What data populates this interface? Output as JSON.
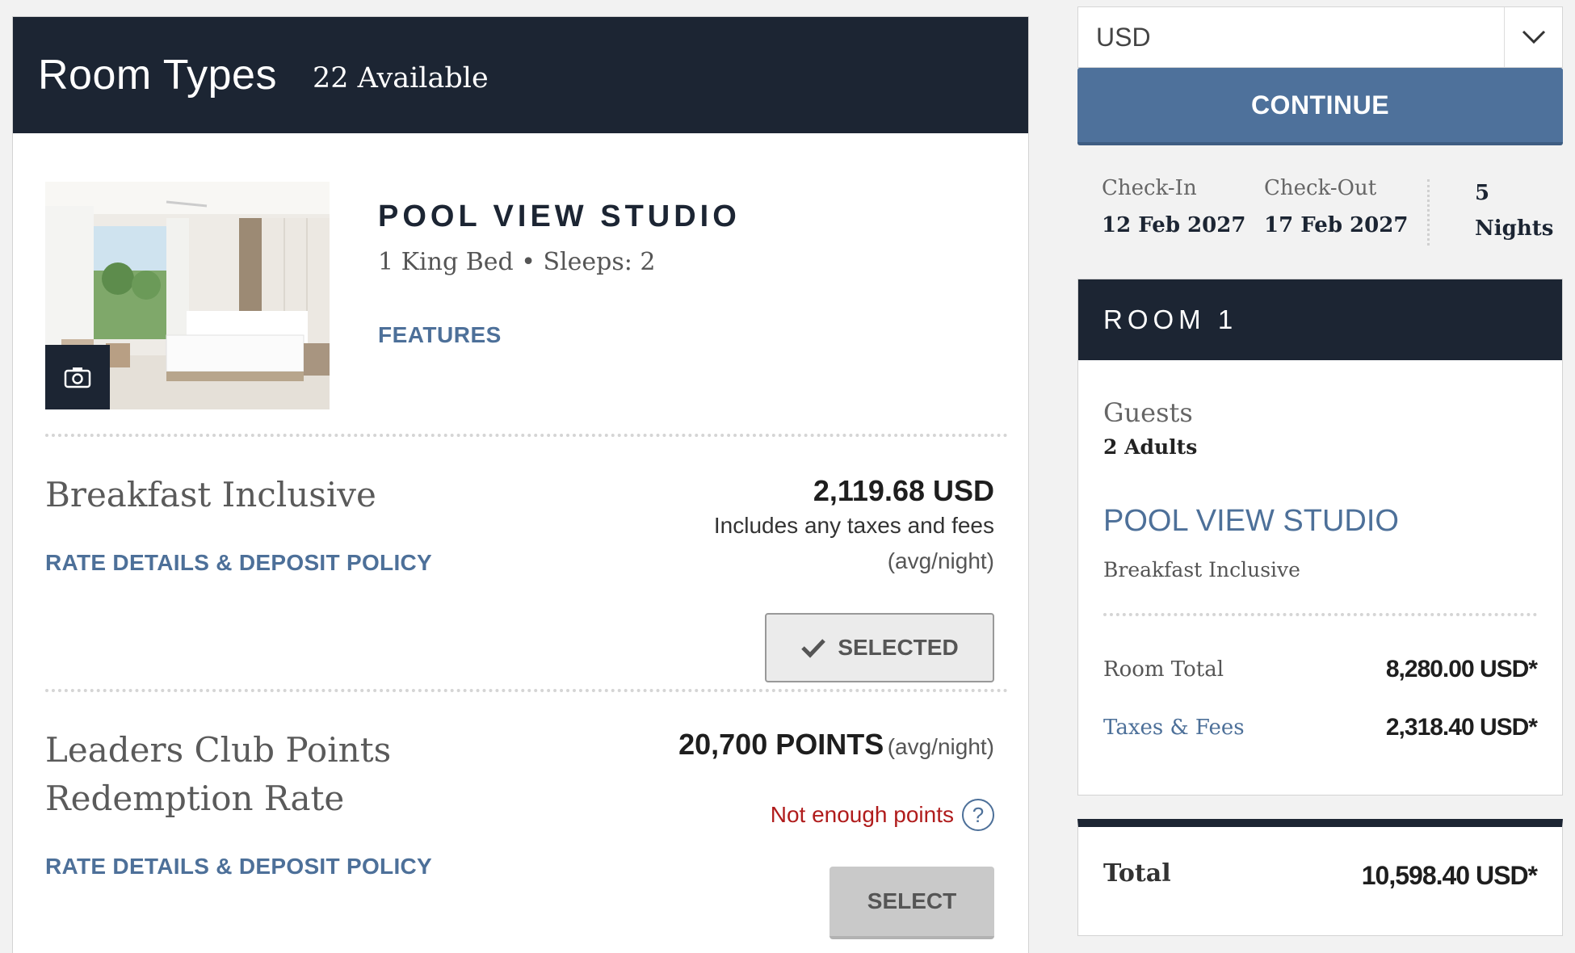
{
  "room_types": {
    "title": "Room Types",
    "available": "22 Available"
  },
  "room": {
    "name": "POOL VIEW STUDIO",
    "details": "1 King Bed • Sleeps: 2",
    "features_label": "FEATURES",
    "camera_icon": "camera-icon"
  },
  "rates": [
    {
      "name": "Breakfast Inclusive",
      "details_link": "RATE DETAILS & DEPOSIT POLICY",
      "price": "2,119.68 USD",
      "price_note": "Includes any taxes and fees",
      "price_unit": "(avg/night)",
      "button_label": "SELECTED",
      "button_icon": "check-icon",
      "selected": true
    },
    {
      "name_line1": "Leaders Club Points",
      "name_line2": "Redemption Rate",
      "details_link": "RATE DETAILS & DEPOSIT POLICY",
      "price": "20,700 POINTS",
      "price_unit": "(avg/night)",
      "warning": "Not enough points",
      "help_icon": "?",
      "button_label": "SELECT",
      "selected": false
    }
  ],
  "sidebar": {
    "currency": "USD",
    "continue_label": "CONTINUE",
    "check_in_label": "Check-In",
    "check_in_value": "12 Feb 2027",
    "check_out_label": "Check-Out",
    "check_out_value": "17 Feb 2027",
    "nights_count": "5",
    "nights_label": "Nights",
    "room_box": {
      "title": "ROOM 1",
      "guests_label": "Guests",
      "guests_value": "2 Adults",
      "room_name": "POOL VIEW STUDIO",
      "rate_name": "Breakfast Inclusive",
      "room_total_label": "Room Total",
      "room_total_value": "8,280.00 USD*",
      "taxes_label": "Taxes & Fees",
      "taxes_value": "2,318.40 USD*"
    },
    "total_label": "Total",
    "total_value": "10,598.40 USD*"
  },
  "colors": {
    "navy": "#1c2533",
    "accent_blue": "#4d7099",
    "button_blue": "#4e719b",
    "warning_red": "#b01c1c"
  }
}
